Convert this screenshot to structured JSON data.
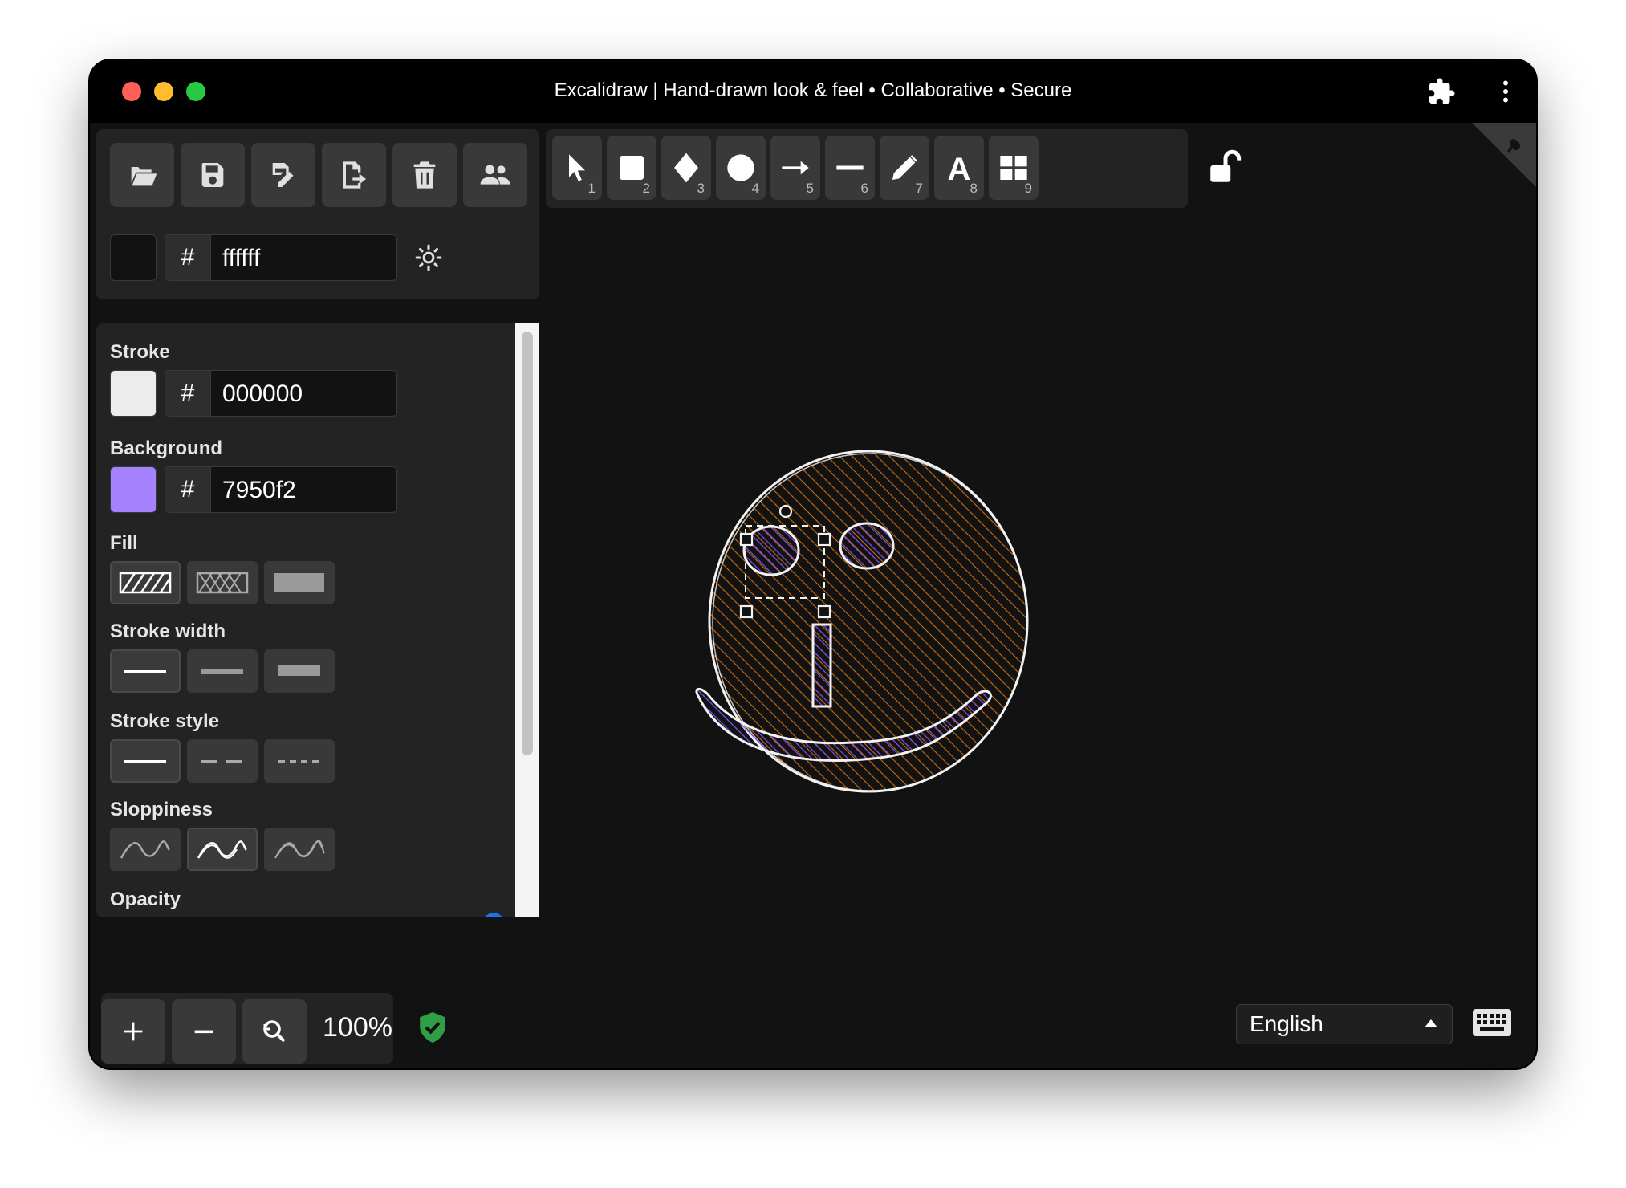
{
  "window": {
    "title": "Excalidraw | Hand-drawn look & feel • Collaborative • Secure"
  },
  "file_menu": {
    "buttons": [
      {
        "icon": "folder-open-icon"
      },
      {
        "icon": "save-icon"
      },
      {
        "icon": "save-as-icon"
      },
      {
        "icon": "export-icon"
      },
      {
        "icon": "trash-icon"
      },
      {
        "icon": "collaborate-icon"
      }
    ],
    "canvas_background": {
      "hash": "#",
      "value": "ffffff",
      "swatch_color": "#121212"
    },
    "theme_icon": "sun-icon"
  },
  "properties": {
    "stroke": {
      "label": "Stroke",
      "hash": "#",
      "value": "000000",
      "swatch_color": "#ececec"
    },
    "background": {
      "label": "Background",
      "hash": "#",
      "value": "7950f2",
      "swatch_color": "#a583ff"
    },
    "fill": {
      "label": "Fill",
      "options": [
        "hachure",
        "cross-hatch",
        "solid"
      ],
      "selected": "hachure"
    },
    "stroke_width": {
      "label": "Stroke width",
      "options": [
        "thin",
        "bold",
        "extra-bold"
      ],
      "selected": "thin"
    },
    "stroke_style": {
      "label": "Stroke style",
      "options": [
        "solid",
        "dashed",
        "dotted"
      ],
      "selected": "solid"
    },
    "sloppiness": {
      "label": "Sloppiness",
      "options": [
        "architect",
        "artist",
        "cartoonist"
      ],
      "selected": "artist"
    },
    "opacity": {
      "label": "Opacity"
    }
  },
  "toolbar": {
    "tools": [
      {
        "icon": "selection-arrow-icon",
        "key": "1"
      },
      {
        "icon": "rectangle-icon",
        "key": "2"
      },
      {
        "icon": "diamond-icon",
        "key": "3"
      },
      {
        "icon": "ellipse-icon",
        "key": "4"
      },
      {
        "icon": "arrow-icon",
        "key": "5"
      },
      {
        "icon": "line-icon",
        "key": "6"
      },
      {
        "icon": "pencil-icon",
        "key": "7"
      },
      {
        "icon": "text-icon",
        "key": "8"
      },
      {
        "icon": "library-icon",
        "key": "9"
      }
    ],
    "lock_icon": "unlock-icon"
  },
  "zoom": {
    "value": "100%"
  },
  "footer": {
    "language": "English",
    "keyboard_icon": "keyboard-icon"
  },
  "colors": {
    "window_bg": "#121212",
    "panel_bg": "#232323",
    "button_bg": "#393939",
    "face_fill": "#c76b0c",
    "eye_fill": "#7950f2"
  }
}
